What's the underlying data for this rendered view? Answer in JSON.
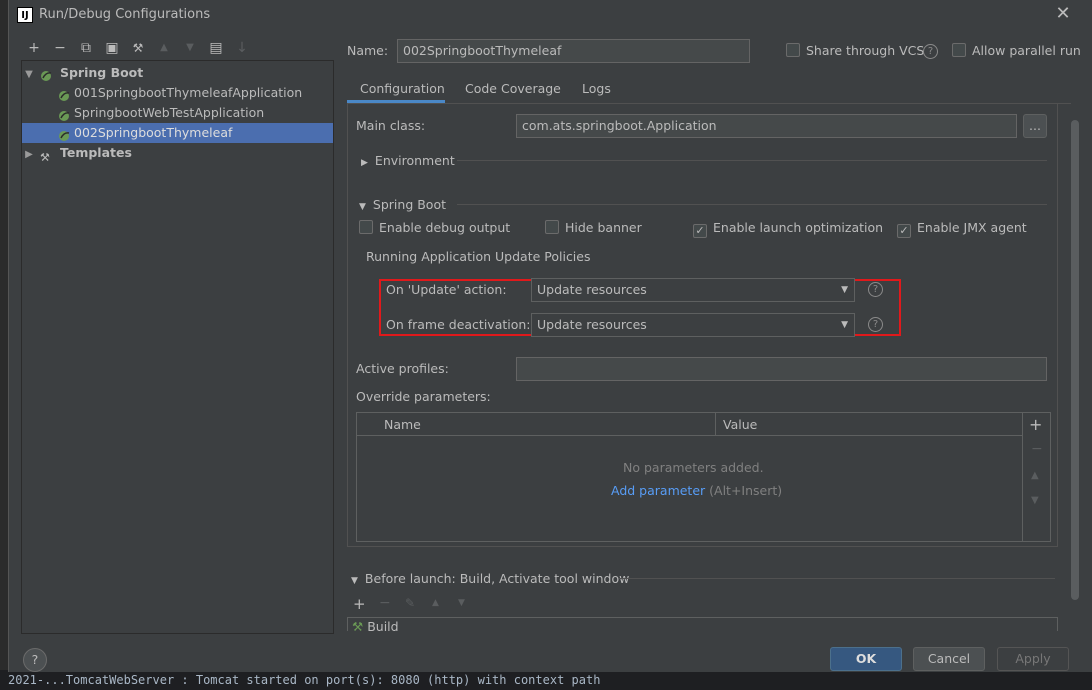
{
  "window": {
    "title": "Run/Debug Configurations",
    "icon_letter": "IJ"
  },
  "toolbar": {
    "add": "+",
    "remove": "−",
    "copy": "⧉",
    "save": "▣",
    "edit": "🔧",
    "up": "▲",
    "down": "▼",
    "folder": "▤",
    "sort": "↓"
  },
  "tree": {
    "spring_boot": "Spring Boot",
    "items": [
      {
        "label": "001SpringbootThymeleafApplication"
      },
      {
        "label": "SpringbootWebTestApplication"
      },
      {
        "label": "002SpringbootThymeleaf"
      }
    ],
    "templates": "Templates"
  },
  "name": {
    "label": "Name:",
    "value": "002SpringbootThymeleaf"
  },
  "share_vcs": "Share through VCS",
  "allow_parallel": "Allow parallel run",
  "tabs": [
    "Configuration",
    "Code Coverage",
    "Logs"
  ],
  "main_class": {
    "label": "Main class:",
    "value": "com.ats.springboot.Application",
    "browse": "..."
  },
  "environment": "Environment",
  "spring_boot_section": "Spring Boot",
  "checks": [
    {
      "label": "Enable debug output",
      "checked": false
    },
    {
      "label": "Hide banner",
      "checked": false
    },
    {
      "label": "Enable launch optimization",
      "checked": true
    },
    {
      "label": "Enable JMX agent",
      "checked": true
    }
  ],
  "policies": {
    "title": "Running Application Update Policies",
    "update_label": "On 'Update' action:",
    "update_value": "Update resources",
    "frame_label": "On frame deactivation:",
    "frame_value": "Update resources",
    "highlight_color": "#e0191b"
  },
  "active_profiles": {
    "label": "Active profiles:",
    "value": ""
  },
  "override": {
    "label": "Override parameters:",
    "col_name": "Name",
    "col_value": "Value",
    "empty": "No parameters added.",
    "add_link": "Add parameter",
    "add_hint": "(Alt+Insert)"
  },
  "before_launch": {
    "label": "Before launch: Build, Activate tool window",
    "item": "Build"
  },
  "buttons": {
    "ok": "OK",
    "cancel": "Cancel",
    "apply": "Apply",
    "help": "?"
  },
  "background_console": "2021-...TomcatWebServer    : Tomcat started on port(s): 8080 (http) with context path"
}
